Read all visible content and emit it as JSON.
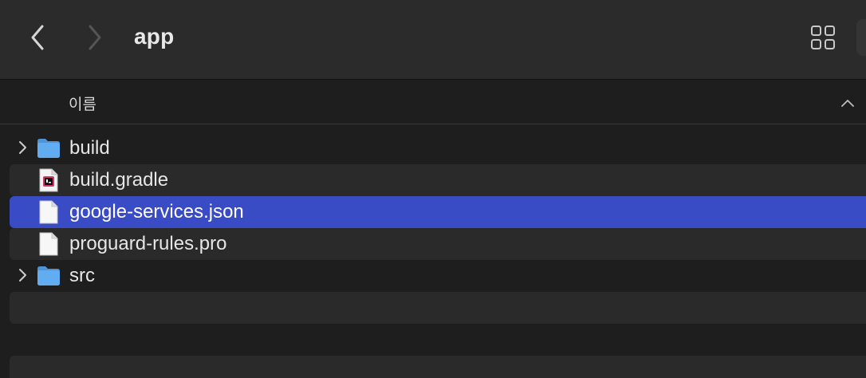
{
  "toolbar": {
    "title": "app",
    "back_icon": "chevron-left-icon",
    "forward_icon": "chevron-right-icon",
    "view_icon": "grid-view-icon"
  },
  "header": {
    "name_column": "이름",
    "sort_icon": "chevron-up-icon"
  },
  "files": [
    {
      "name": "build",
      "type": "folder",
      "expandable": true,
      "selected": false
    },
    {
      "name": "build.gradle",
      "type": "gradle-file",
      "expandable": false,
      "selected": false
    },
    {
      "name": "google-services.json",
      "type": "document",
      "expandable": false,
      "selected": true
    },
    {
      "name": "proguard-rules.pro",
      "type": "document",
      "expandable": false,
      "selected": false
    },
    {
      "name": "src",
      "type": "folder",
      "expandable": true,
      "selected": false
    }
  ],
  "colors": {
    "selection": "#3a4bc6",
    "folder": "#5ca8f0",
    "toolbar": "#2b2b2b",
    "background": "#1e1e1e"
  }
}
